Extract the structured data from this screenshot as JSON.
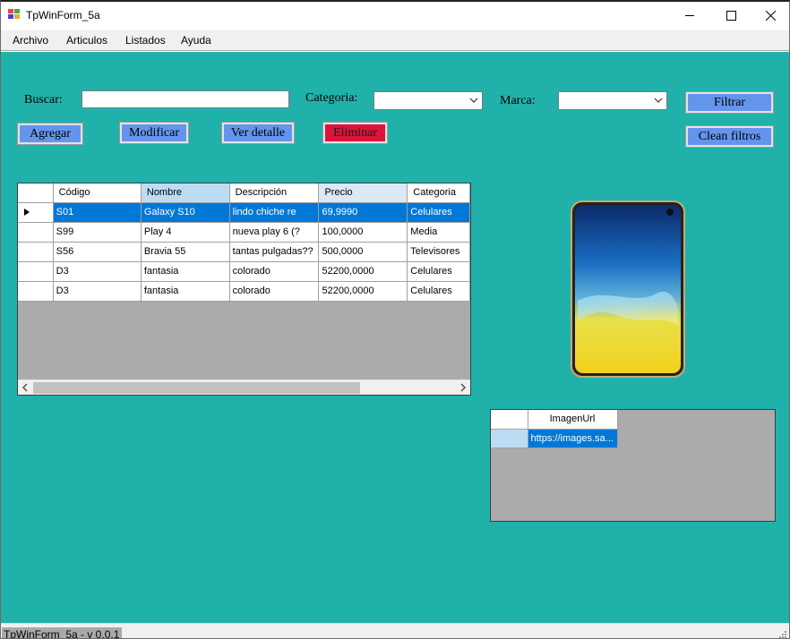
{
  "window": {
    "title": "TpWinForm_5a"
  },
  "menu": [
    "Archivo",
    "Articulos",
    "Listados",
    "Ayuda"
  ],
  "filters": {
    "search_label": "Buscar:",
    "search_value": "",
    "category_label": "Categoria:",
    "category_value": "",
    "brand_label": "Marca:",
    "brand_value": "",
    "filter_button": "Filtrar",
    "clear_button": "Clean filtros"
  },
  "actions": {
    "add": "Agregar",
    "edit": "Modificar",
    "detail": "Ver detalle",
    "delete": "Eliminar"
  },
  "grid": {
    "columns": [
      "Código",
      "Nombre",
      "Descripción",
      "Precio",
      "Categoria"
    ],
    "rows": [
      [
        "S01",
        "Galaxy S10",
        "lindo chiche re",
        "69,9990",
        "Celulares"
      ],
      [
        "S99",
        "Play 4",
        "nueva play 6 (?",
        "100,0000",
        "Media"
      ],
      [
        "S56",
        "Bravia 55",
        "tantas pulgadas??",
        "500,0000",
        "Televisores"
      ],
      [
        "D3",
        "fantasia",
        "colorado",
        "52200,0000",
        "Celulares"
      ],
      [
        "D3",
        "fantasia",
        "colorado",
        "52200,0000",
        "Celulares"
      ]
    ],
    "selected_row": 0
  },
  "images": {
    "column": "ImagenUrl",
    "rows": [
      "https://images.sa..."
    ]
  },
  "status": {
    "text": "TpWinForm_5a - v 0.0.1"
  },
  "colors": {
    "background": "#20b2aa",
    "button": "#6495ed",
    "delete_button": "#dc143c",
    "selection": "#0078d7"
  }
}
